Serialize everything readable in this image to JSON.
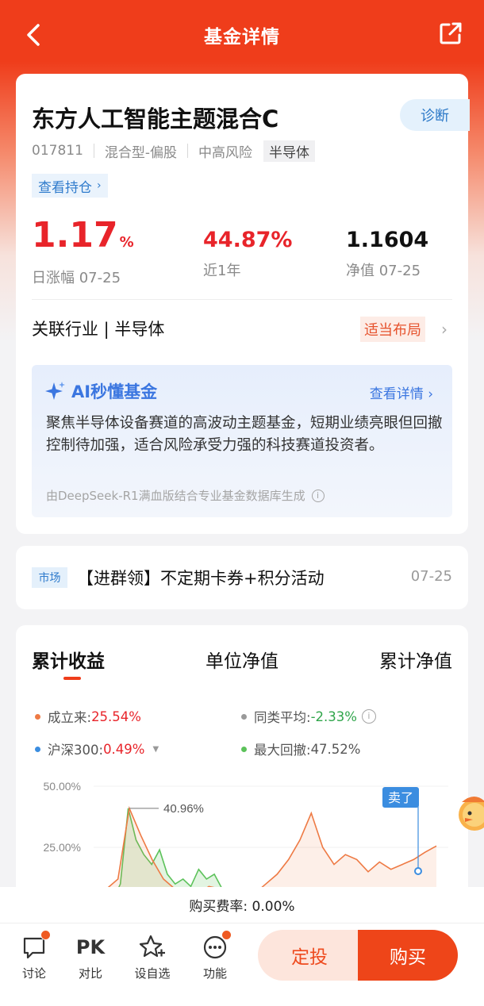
{
  "nav": {
    "title": "基金详情"
  },
  "fund": {
    "name": "东方人工智能主题混合C",
    "code": "017811",
    "type": "混合型-偏股",
    "risk": "中高风险",
    "sector_tag": "半导体",
    "diagnose_label": "诊断",
    "holdings_label": "查看持仓"
  },
  "stats": {
    "daily_change_value": "1.17",
    "daily_change_unit": "%",
    "daily_change_label": "日涨幅 07-25",
    "year_return_value": "44.87%",
    "year_return_label": "近1年",
    "nav_value": "1.1604",
    "nav_label": "净值 07-25"
  },
  "industry": {
    "label": "关联行业 | 半导体",
    "tag": "适当布局"
  },
  "ai": {
    "title": "AI秒懂基金",
    "more_label": "查看详情",
    "text": "聚焦半导体设备赛道的高波动主题基金，短期业绩亮眼但回撤控制待加强，适合风险承受力强的科技赛道投资者。",
    "source": "由DeepSeek-R1满血版结合专业基金数据库生成"
  },
  "market": {
    "tag": "市场",
    "text": "【进群领】不定期卡券+积分活动",
    "date": "07-25"
  },
  "chart_tabs": [
    "累计收益",
    "单位净值",
    "累计净值"
  ],
  "legend": {
    "since_inception_label": "成立来:",
    "since_inception_value": "25.54%",
    "peer_avg_label": "同类平均:",
    "peer_avg_value": "-2.33%",
    "hs300_label": "沪深300:",
    "hs300_value": "0.49%",
    "max_drawdown_label": "最大回撤:",
    "max_drawdown_value": "47.52%"
  },
  "colors": {
    "brand": "#ef3d1b",
    "fund_series": "#ee7a44",
    "drawdown_series": "#5cc25a",
    "hs300_series": "#3b8de0",
    "peer_series": "#999999"
  },
  "chart_data": {
    "type": "area",
    "ylim": [
      0,
      50
    ],
    "yticks": [
      "50.00%",
      "25.00%"
    ],
    "annotations": {
      "peak_label": "40.96%",
      "sell_label": "卖了"
    },
    "series": [
      {
        "values": [
          5,
          8,
          12,
          40.96,
          30,
          20,
          12,
          8,
          5,
          6,
          9,
          8,
          5,
          4,
          6,
          10,
          14,
          20,
          28,
          39,
          25,
          18,
          22,
          20,
          15,
          19,
          16,
          18,
          20,
          23,
          25.54
        ]
      },
      {
        "values": [
          0,
          3,
          10,
          40.96,
          28,
          22,
          18,
          24,
          14,
          10,
          12,
          9,
          16,
          12,
          14,
          8
        ]
      }
    ]
  },
  "fee": {
    "label": "购买费率: 0.00%"
  },
  "bottom": {
    "discuss": "讨论",
    "compare_icon_text": "PK",
    "compare": "对比",
    "watchlist": "设自选",
    "functions": "功能",
    "auto_invest": "定投",
    "buy": "购买"
  }
}
